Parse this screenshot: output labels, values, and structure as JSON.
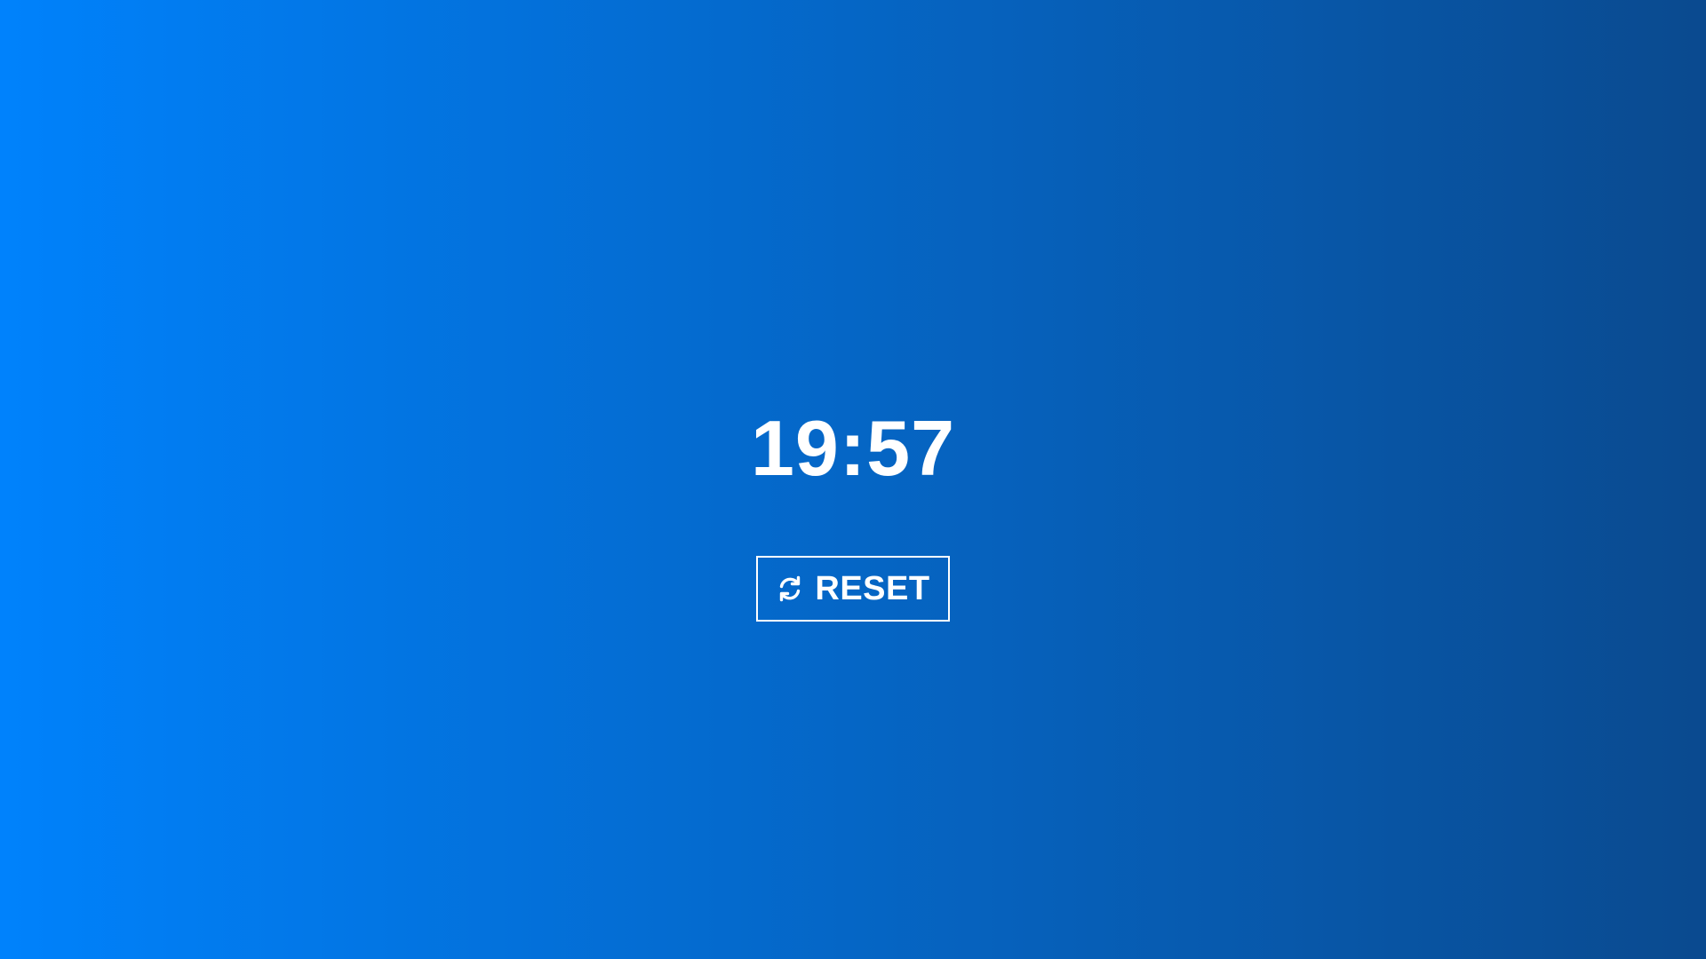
{
  "timer": {
    "display": "19:57"
  },
  "reset_button": {
    "label": "RESET",
    "icon": "refresh-icon"
  },
  "colors": {
    "gradient_start": "#0082fc",
    "gradient_end": "#0a4a8f",
    "text": "#ffffff"
  }
}
